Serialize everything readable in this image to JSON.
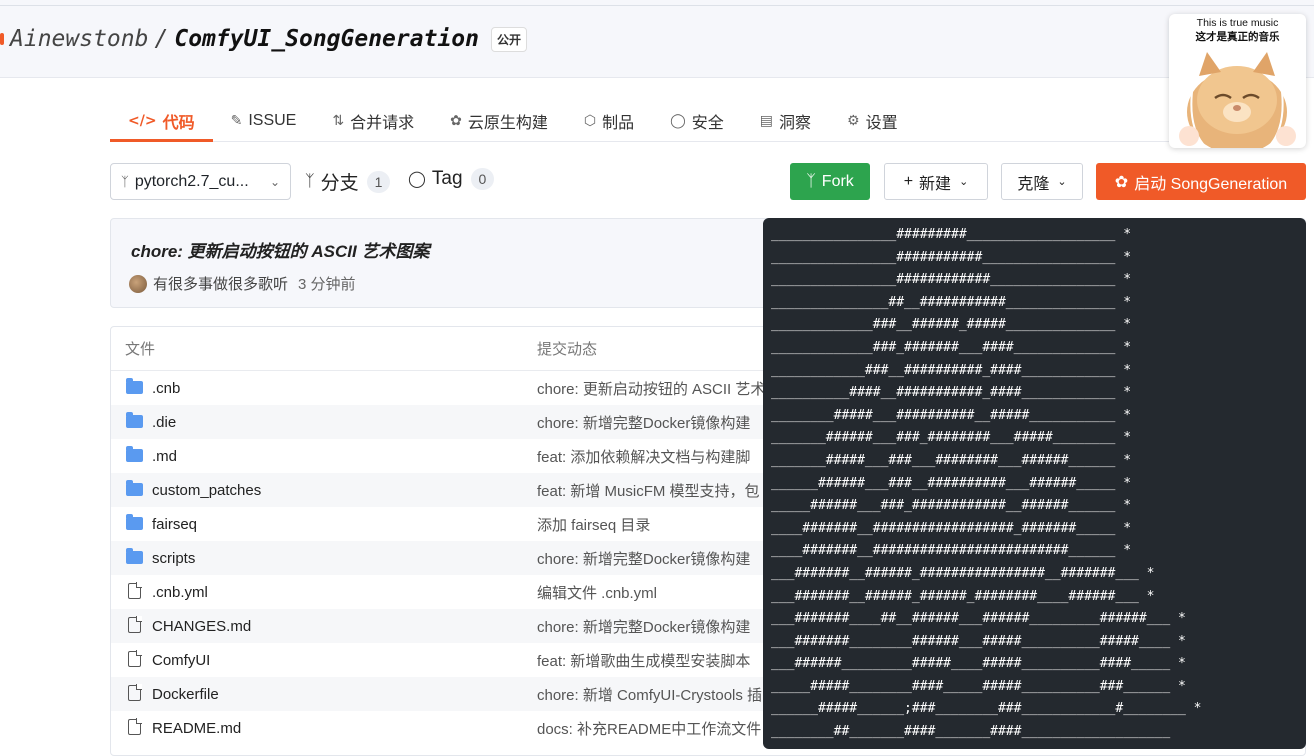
{
  "repo": {
    "owner": "Ainewstonb",
    "separator": "/",
    "name": "ComfyUI_SongGeneration",
    "visibility": "公开"
  },
  "tabs": [
    {
      "icon": "</>",
      "label": "代码",
      "active": true
    },
    {
      "icon": "issue-icon",
      "label": "ISSUE"
    },
    {
      "icon": "merge-icon",
      "label": "合并请求"
    },
    {
      "icon": "cloud-build-icon",
      "label": "云原生构建"
    },
    {
      "icon": "package-icon",
      "label": "制品"
    },
    {
      "icon": "shield-icon",
      "label": "安全"
    },
    {
      "icon": "insights-icon",
      "label": "洞察"
    },
    {
      "icon": "gear-icon",
      "label": "设置"
    }
  ],
  "branch": {
    "name": "pytorch2.7_cu...",
    "icon": "branch-icon"
  },
  "meta": {
    "branches_label": "分支",
    "branches_count": "1",
    "tags_label": "Tag",
    "tags_count": "0"
  },
  "actions": {
    "fork": "Fork",
    "new": "新建",
    "clone": "克隆",
    "launch": "启动 SongGeneration"
  },
  "colors": {
    "accent": "#f05a28",
    "fork": "#2da44e",
    "tooltip_bg": "#24292f",
    "folder": "#5a9af0"
  },
  "commit": {
    "title": "chore: 更新启动按钮的 ASCII 艺术图案",
    "author": "有很多事做很多歌听",
    "time": "3 分钟前"
  },
  "table": {
    "header_file": "文件",
    "header_commit": "提交动态",
    "rows": [
      {
        "type": "folder",
        "name": ".cnb",
        "msg": "chore: 更新启动按钮的 ASCII 艺术"
      },
      {
        "type": "folder",
        "name": ".die",
        "msg": "chore: 新增完整Docker镜像构建"
      },
      {
        "type": "folder",
        "name": ".md",
        "msg": "feat: 添加依赖解决文档与构建脚"
      },
      {
        "type": "folder",
        "name": "custom_patches",
        "msg": "feat: 新增 MusicFM 模型支持，包"
      },
      {
        "type": "folder",
        "name": "fairseq",
        "msg": "添加 fairseq 目录"
      },
      {
        "type": "folder",
        "name": "scripts",
        "msg": "chore: 新增完整Docker镜像构建"
      },
      {
        "type": "file",
        "name": ".cnb.yml",
        "msg": "编辑文件 .cnb.yml"
      },
      {
        "type": "file",
        "name": "CHANGES.md",
        "msg": "chore: 新增完整Docker镜像构建"
      },
      {
        "type": "link",
        "name": "ComfyUI",
        "msg": "feat: 新增歌曲生成模型安装脚本"
      },
      {
        "type": "file",
        "name": "Dockerfile",
        "msg": "chore: 新增 ComfyUI-Crystools 插"
      },
      {
        "type": "file",
        "name": "README.md",
        "msg": "docs: 补充README中工作流文件"
      }
    ]
  },
  "tooltip": {
    "ascii_lines": [
      "________________#########___________________ *",
      "________________###########_________________ *",
      "________________############________________ *",
      "_______________##__###########______________ *",
      "_____________###__######_#####______________ *",
      "_____________###_#######___####_____________ *",
      "____________###__##########_####____________ *",
      "__________####__###########_####____________ *",
      "________#####___##########__#####___________ *",
      "_______######___###_########___#####________ *",
      "_______#####___###___########___######______ *",
      "______######___###__##########___######_____ *",
      "_____######___###_############__######______ *",
      "____#######__##################_#######_____ *",
      "____#######__#########################______ *",
      "___#######__######_################__#######___ *",
      "___#######__######_######_########____######___ *",
      "___#######____##__######___######_________######___ *",
      "___#######________######___#####__________#####____ *",
      "___######_________#####____#####__________####_____ *",
      "_____#####________####_____#####__________###______ *",
      "______#####______;###________###____________#________ *",
      "________##_______####_______####___________________"
    ]
  },
  "sticker": {
    "line1": "This is true music",
    "line2": "这才是真正的音乐"
  }
}
